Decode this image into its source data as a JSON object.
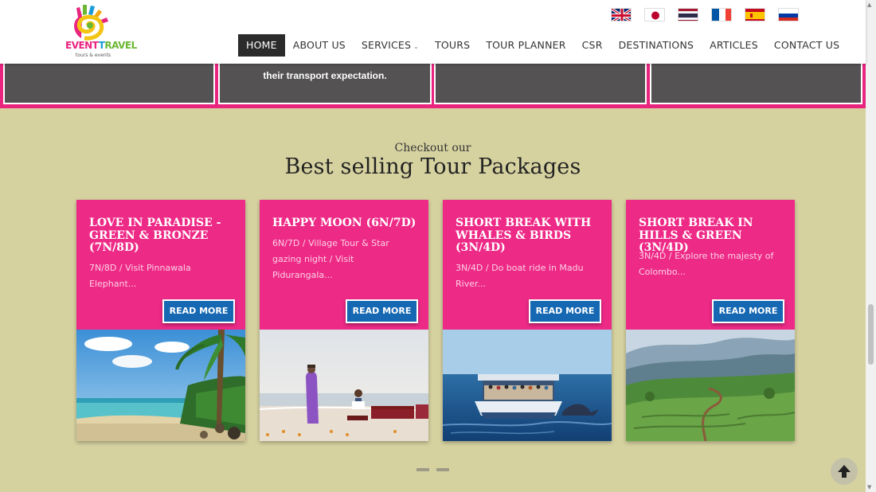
{
  "header": {
    "logo": {
      "brand_part1": "EVENT",
      "brand_part2": "RAVEL",
      "tagline": "tours & events"
    },
    "flags": [
      {
        "name": "english",
        "country": "United Kingdom"
      },
      {
        "name": "japanese",
        "country": "Japan"
      },
      {
        "name": "thai",
        "country": "Thailand"
      },
      {
        "name": "french",
        "country": "France"
      },
      {
        "name": "spanish",
        "country": "Spain"
      },
      {
        "name": "russian",
        "country": "Russia"
      }
    ],
    "nav": [
      {
        "label": "HOME",
        "active": true
      },
      {
        "label": "ABOUT US"
      },
      {
        "label": "SERVICES",
        "dropdown": true
      },
      {
        "label": "TOURS"
      },
      {
        "label": "TOUR PLANNER"
      },
      {
        "label": "CSR"
      },
      {
        "label": "DESTINATIONS"
      },
      {
        "label": "ARTICLES"
      },
      {
        "label": "CONTACT US"
      }
    ]
  },
  "top_strip": {
    "cards": [
      {
        "text": ""
      },
      {
        "text": "their transport expectation."
      },
      {
        "text": ""
      },
      {
        "text": ""
      }
    ]
  },
  "packages": {
    "kicker": "Checkout our",
    "title": "Best selling Tour Packages",
    "items": [
      {
        "title": "LOVE IN PARADISE - GREEN & BRONZE (7N/8D)",
        "description": "7N/8D / Visit Pinnawala Elephant...",
        "button": "READ MORE",
        "image": "beach-palms"
      },
      {
        "title": "HAPPY MOON (6N/7D)",
        "description": "6N/7D / Village Tour & Star gazing night / Visit Pidurangala...",
        "button": "READ MORE",
        "image": "beach-dinner"
      },
      {
        "title": "SHORT BREAK WITH WHALES & BIRDS (3N/4D)",
        "description": "3N/4D / Do boat ride in Madu River...",
        "button": "READ MORE",
        "image": "whale-boat"
      },
      {
        "title": "SHORT BREAK IN HILLS & GREEN (3N/4D)",
        "description": "3N/4D / Explore the majesty of Colombo...",
        "button": "READ MORE",
        "image": "tea-hills"
      }
    ]
  },
  "carousel": {
    "dots": 2
  },
  "colors": {
    "accent_pink": "#ee2a87",
    "button_blue": "#1668b3",
    "section_bg": "#d6d2a0",
    "nav_active": "#2b2b2b"
  },
  "icons": {
    "back_to_top": "arrow-up-icon"
  }
}
